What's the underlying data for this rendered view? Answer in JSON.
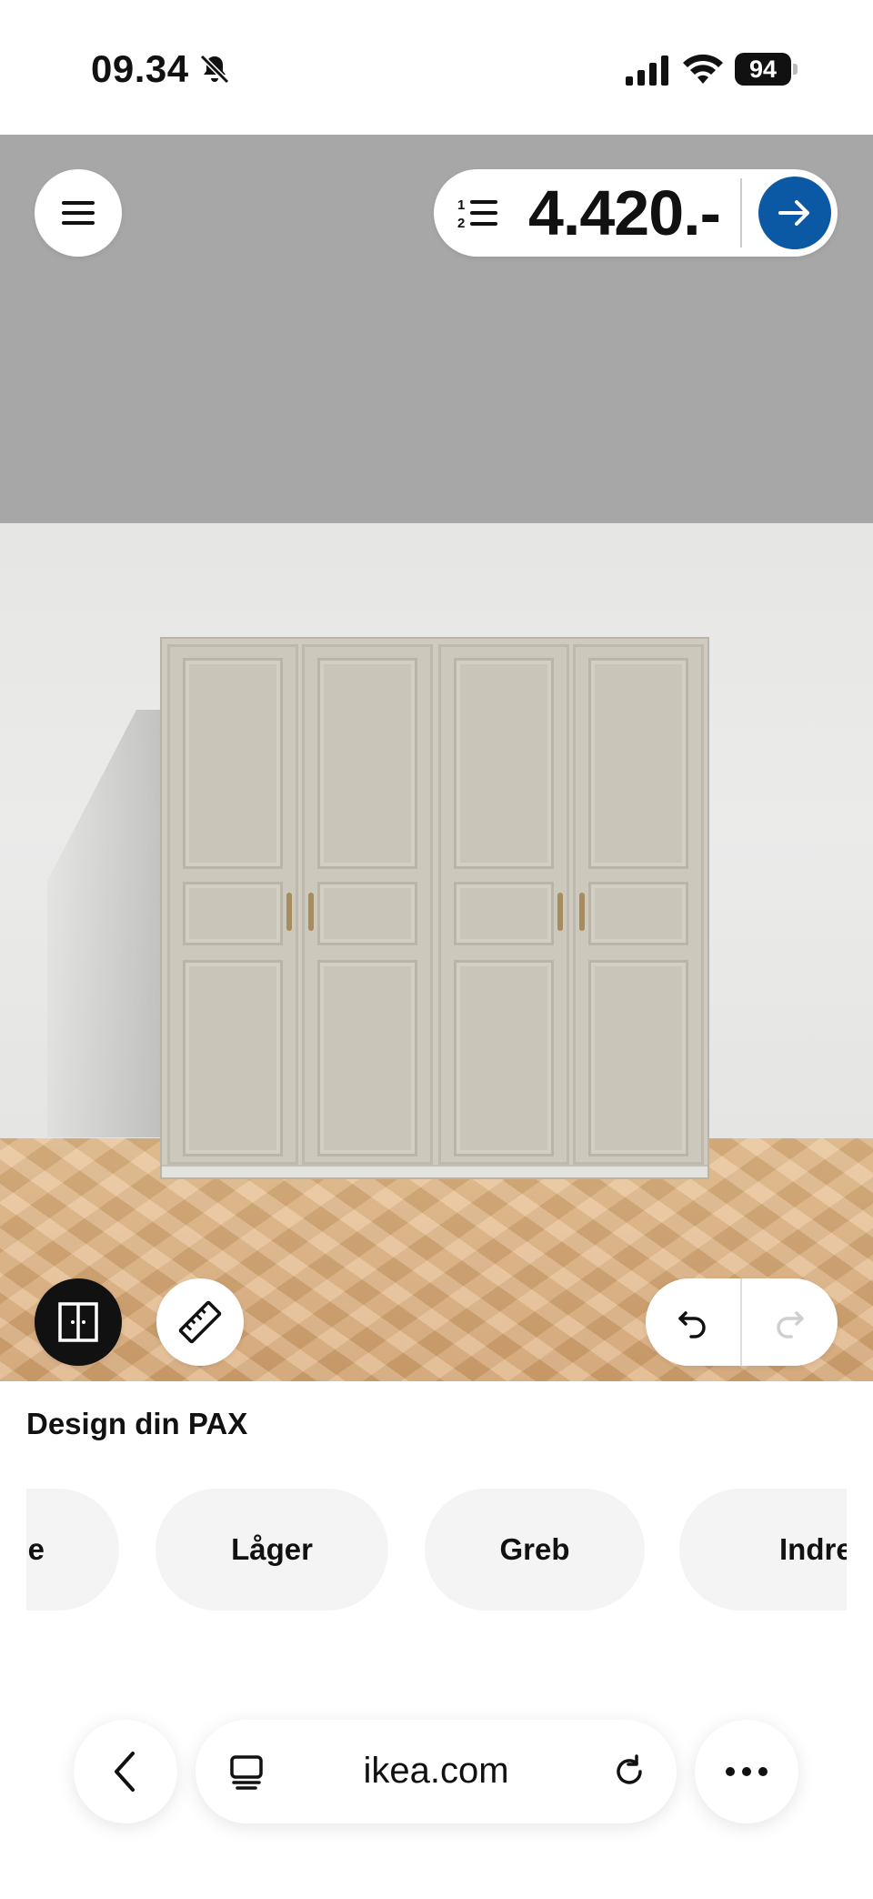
{
  "status_bar": {
    "time": "09.34",
    "battery": "94",
    "icons": [
      "bell-slash-icon",
      "cellular-signal-icon",
      "wifi-icon",
      "battery-icon"
    ]
  },
  "toolbar": {
    "menu_icon": "hamburger-menu-icon",
    "list_icon": "numbered-list-icon",
    "price": "4.420.-",
    "go_icon": "arrow-right-icon",
    "accent_color": "#0b58a5"
  },
  "scene_controls": {
    "door_view_icon": "wardrobe-doors-icon",
    "ruler_icon": "ruler-icon",
    "undo_icon": "undo-icon",
    "redo_icon": "redo-icon"
  },
  "design": {
    "title": "Design din PAX",
    "tabs": [
      {
        "label": "le"
      },
      {
        "label": "Låger"
      },
      {
        "label": "Greb"
      },
      {
        "label": "Indret"
      }
    ]
  },
  "browser": {
    "url": "ikea.com",
    "back_icon": "chevron-left-icon",
    "tabs_icon": "tabs-icon",
    "reload_icon": "reload-icon",
    "more_icon": "more-dots-icon"
  }
}
